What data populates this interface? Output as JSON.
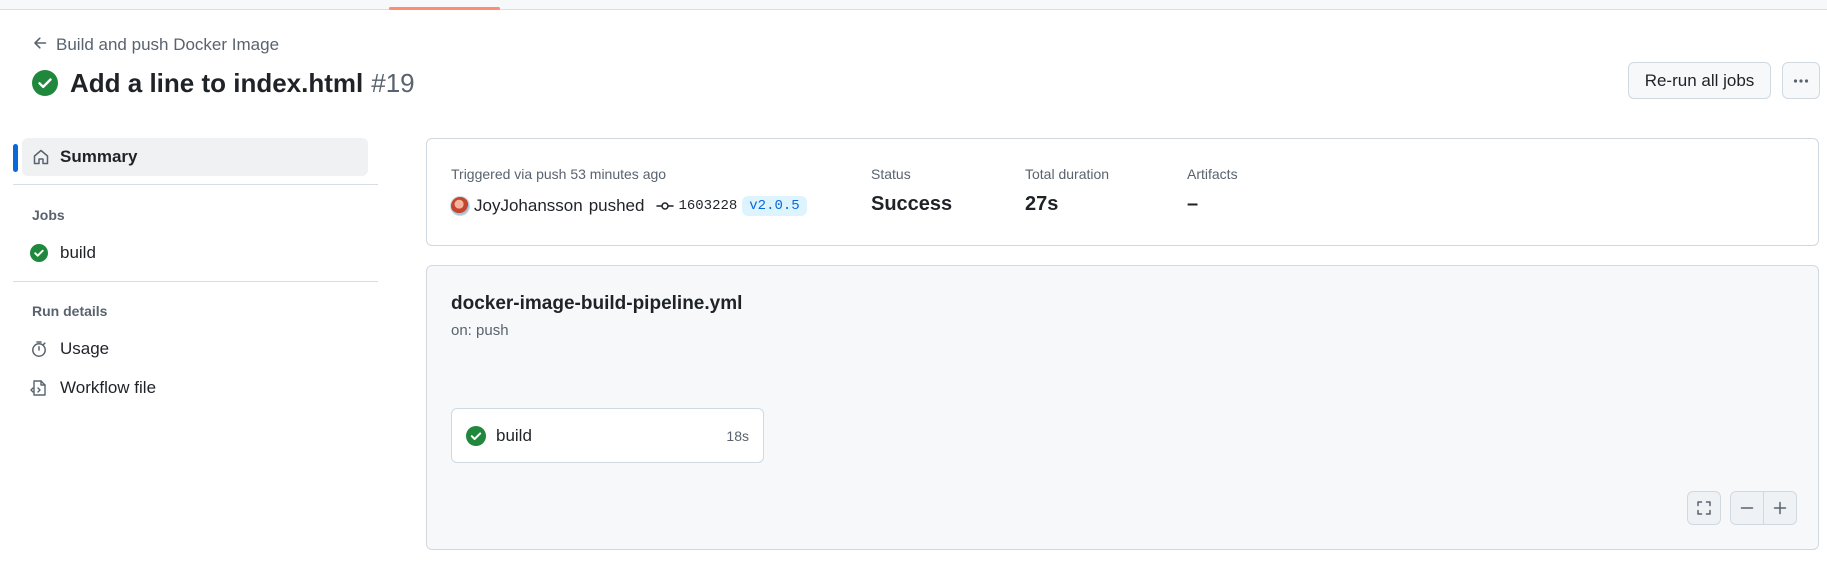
{
  "header": {
    "back_label": "Build and push Docker Image",
    "title": "Add a line to index.html",
    "run_number": "#19",
    "rerun_label": "Re-run all jobs"
  },
  "sidebar": {
    "summary_label": "Summary",
    "jobs_heading": "Jobs",
    "jobs": [
      {
        "label": "build",
        "status": "success"
      }
    ],
    "run_details_heading": "Run details",
    "run_details": [
      {
        "label": "Usage",
        "icon": "stopwatch-icon"
      },
      {
        "label": "Workflow file",
        "icon": "file-code-icon"
      }
    ]
  },
  "summary": {
    "trigger_text": "Triggered via push 53 minutes ago",
    "actor": "JoyJohansson",
    "action": "pushed",
    "commit_sha": "1603228",
    "tag": "v2.0.5",
    "status_label": "Status",
    "status_value": "Success",
    "duration_label": "Total duration",
    "duration_value": "27s",
    "artifacts_label": "Artifacts",
    "artifacts_value": "–"
  },
  "graph": {
    "workflow_file": "docker-image-build-pipeline.yml",
    "trigger": "on: push",
    "job": {
      "name": "build",
      "duration": "18s",
      "status": "success"
    }
  },
  "colors": {
    "success": "#1f883d",
    "accent": "#0969da",
    "tab_underline": "#fd8c73"
  }
}
